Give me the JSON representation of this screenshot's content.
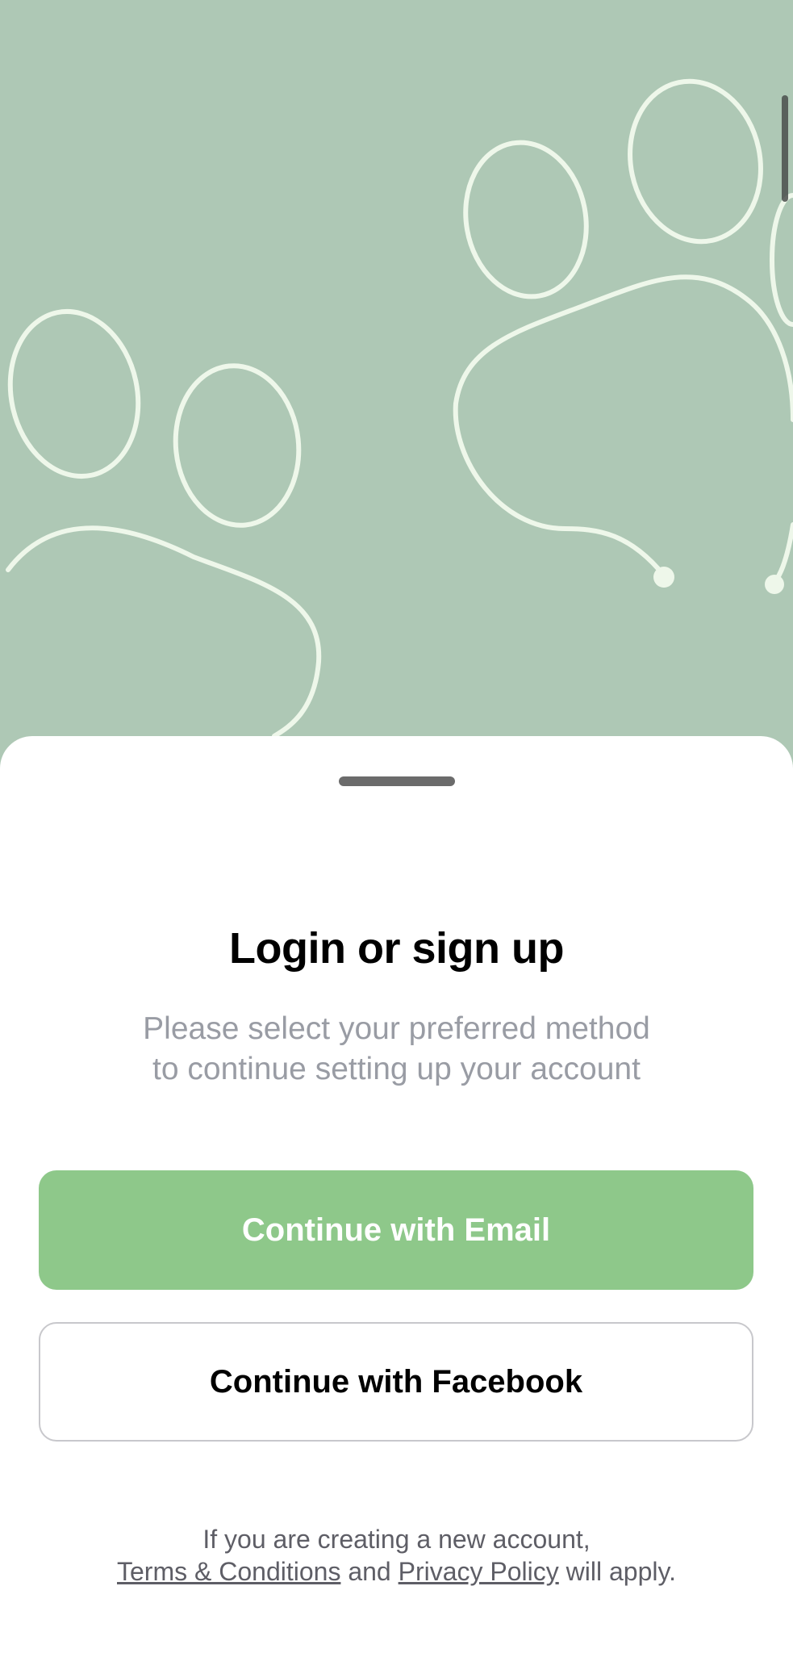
{
  "login_sheet": {
    "title": "Login or sign up",
    "subtitle_line1": "Please select your preferred method",
    "subtitle_line2": "to continue setting up your account",
    "email_button_label": "Continue with Email",
    "facebook_button_label": "Continue with Facebook",
    "legal_line1": "If you are creating a new account,",
    "terms_link": "Terms & Conditions",
    "legal_and": "and",
    "privacy_link": "Privacy Policy",
    "legal_suffix": "will apply."
  },
  "colors": {
    "hero_background": "#aec8b5",
    "paw_outline": "#eef7ea",
    "email_button": "#8ec88a",
    "subtitle_text": "#999ca4"
  },
  "icons": {
    "hero_decoration": "paw-print-outline-icon"
  }
}
